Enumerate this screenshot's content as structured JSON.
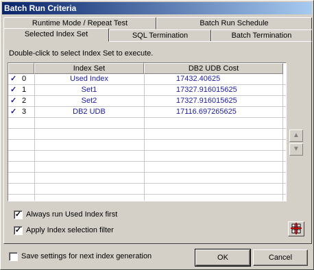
{
  "window": {
    "title": "Batch Run Criteria"
  },
  "tabs": {
    "row1": [
      {
        "label": "Runtime Mode / Repeat Test"
      },
      {
        "label": "Batch Run Schedule"
      }
    ],
    "row2": [
      {
        "label": "Selected Index Set",
        "active": true
      },
      {
        "label": "SQL Termination"
      },
      {
        "label": "Batch Termination"
      }
    ]
  },
  "panel": {
    "hint": "Double-click to select Index Set to execute.",
    "grid": {
      "columns": [
        "Index Set",
        "DB2 UDB Cost"
      ],
      "rows": [
        {
          "checked": "✓",
          "num": "0",
          "index_set": "Used Index",
          "cost": "17432.40625"
        },
        {
          "checked": "✓",
          "num": "1",
          "index_set": "Set1",
          "cost": "17327.916015625"
        },
        {
          "checked": "✓",
          "num": "2",
          "index_set": "Set2",
          "cost": "17327.916015625"
        },
        {
          "checked": "✓",
          "num": "3",
          "index_set": "DB2 UDB",
          "cost": "17116.697265625"
        }
      ]
    },
    "options": {
      "always_run": {
        "label": "Always run Used Index first",
        "checked": true
      },
      "apply_filter": {
        "label": "Apply Index selection filter",
        "checked": true
      }
    }
  },
  "footer": {
    "save_settings": {
      "label": "Save settings for next index generation",
      "checked": false
    },
    "ok_label": "OK",
    "cancel_label": "Cancel"
  },
  "icons": {
    "up": "up-arrow-icon",
    "down": "down-arrow-icon",
    "filter": "grid-filter-icon"
  },
  "colors": {
    "title_start": "#0a246a",
    "title_end": "#a6caf0",
    "cell_text": "#1a1aa0",
    "face": "#d4d0c8"
  }
}
